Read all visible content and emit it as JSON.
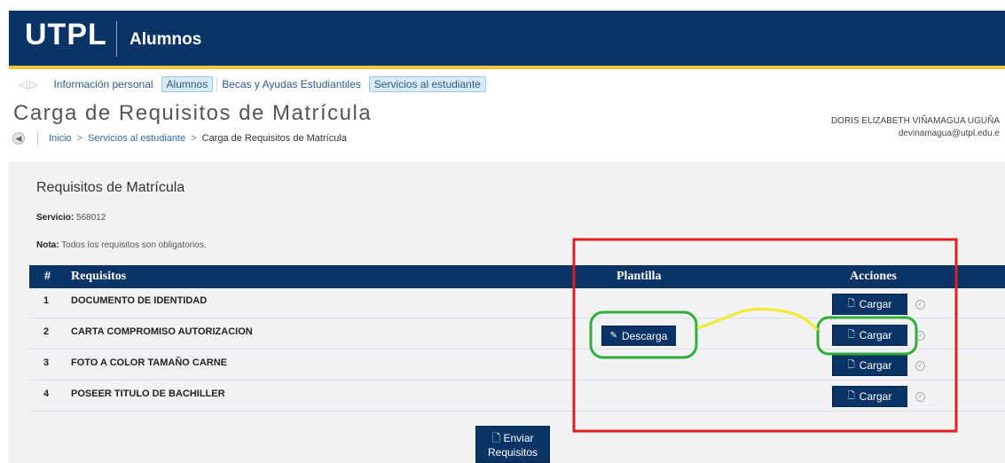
{
  "header": {
    "brand": "UTPL",
    "section": "Alumnos"
  },
  "nav": {
    "arrows": "◁▷",
    "items": [
      {
        "label": "Información personal",
        "active": false
      },
      {
        "label": "Alumnos",
        "active": true
      },
      {
        "label": "Becas y Ayudas Estudiantiles",
        "active": false
      },
      {
        "label": "Servicios al estudiante",
        "active": true
      }
    ]
  },
  "page": {
    "title": "Carga de Requisitos de Matrícula"
  },
  "user": {
    "name": "DORIS ELIZABETH VIÑAMAGUA UGUÑA",
    "email": "devinamagua@utpl.edu.e"
  },
  "breadcrumb": {
    "inicio": "Inicio",
    "servicios": "Servicios al estudiante",
    "current": "Carga de Requisitos de Matrícula",
    "separator": ">"
  },
  "requirements": {
    "title": "Requisitos de Matrícula",
    "service_label": "Servicio:",
    "service_value": "568012",
    "note_label": "Nota:",
    "note_value": "Todos los requisitos son obligatorios.",
    "columns": {
      "num": "#",
      "req": "Requisitos",
      "template": "Plantilla",
      "actions": "Acciones"
    },
    "rows": [
      {
        "num": "1",
        "name": "DOCUMENTO DE IDENTIDAD"
      },
      {
        "num": "2",
        "name": "CARTA COMPROMISO AUTORIZACION"
      },
      {
        "num": "3",
        "name": "FOTO A COLOR TAMAÑO CARNE"
      },
      {
        "num": "4",
        "name": "POSEER TITULO DE BACHILLER"
      }
    ],
    "download_label": "Descarga",
    "upload_label": "Cargar",
    "send_label_1": "Enviar",
    "send_label_2": "Requisitos"
  },
  "colors": {
    "navy": "#0b3466",
    "gold": "#f2c53d",
    "annotation_red": "#e02020",
    "annotation_green": "#2fae3a",
    "annotation_yellow": "#f0ea2a"
  }
}
